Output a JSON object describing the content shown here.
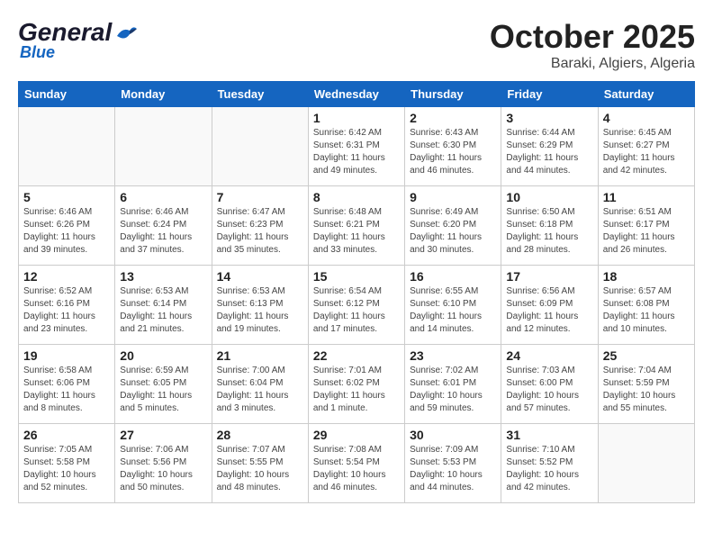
{
  "header": {
    "logo_general": "General",
    "logo_blue": "Blue",
    "month": "October 2025",
    "location": "Baraki, Algiers, Algeria"
  },
  "weekdays": [
    "Sunday",
    "Monday",
    "Tuesday",
    "Wednesday",
    "Thursday",
    "Friday",
    "Saturday"
  ],
  "rows": [
    [
      {
        "day": "",
        "info": ""
      },
      {
        "day": "",
        "info": ""
      },
      {
        "day": "",
        "info": ""
      },
      {
        "day": "1",
        "info": "Sunrise: 6:42 AM\nSunset: 6:31 PM\nDaylight: 11 hours\nand 49 minutes."
      },
      {
        "day": "2",
        "info": "Sunrise: 6:43 AM\nSunset: 6:30 PM\nDaylight: 11 hours\nand 46 minutes."
      },
      {
        "day": "3",
        "info": "Sunrise: 6:44 AM\nSunset: 6:29 PM\nDaylight: 11 hours\nand 44 minutes."
      },
      {
        "day": "4",
        "info": "Sunrise: 6:45 AM\nSunset: 6:27 PM\nDaylight: 11 hours\nand 42 minutes."
      }
    ],
    [
      {
        "day": "5",
        "info": "Sunrise: 6:46 AM\nSunset: 6:26 PM\nDaylight: 11 hours\nand 39 minutes."
      },
      {
        "day": "6",
        "info": "Sunrise: 6:46 AM\nSunset: 6:24 PM\nDaylight: 11 hours\nand 37 minutes."
      },
      {
        "day": "7",
        "info": "Sunrise: 6:47 AM\nSunset: 6:23 PM\nDaylight: 11 hours\nand 35 minutes."
      },
      {
        "day": "8",
        "info": "Sunrise: 6:48 AM\nSunset: 6:21 PM\nDaylight: 11 hours\nand 33 minutes."
      },
      {
        "day": "9",
        "info": "Sunrise: 6:49 AM\nSunset: 6:20 PM\nDaylight: 11 hours\nand 30 minutes."
      },
      {
        "day": "10",
        "info": "Sunrise: 6:50 AM\nSunset: 6:18 PM\nDaylight: 11 hours\nand 28 minutes."
      },
      {
        "day": "11",
        "info": "Sunrise: 6:51 AM\nSunset: 6:17 PM\nDaylight: 11 hours\nand 26 minutes."
      }
    ],
    [
      {
        "day": "12",
        "info": "Sunrise: 6:52 AM\nSunset: 6:16 PM\nDaylight: 11 hours\nand 23 minutes."
      },
      {
        "day": "13",
        "info": "Sunrise: 6:53 AM\nSunset: 6:14 PM\nDaylight: 11 hours\nand 21 minutes."
      },
      {
        "day": "14",
        "info": "Sunrise: 6:53 AM\nSunset: 6:13 PM\nDaylight: 11 hours\nand 19 minutes."
      },
      {
        "day": "15",
        "info": "Sunrise: 6:54 AM\nSunset: 6:12 PM\nDaylight: 11 hours\nand 17 minutes."
      },
      {
        "day": "16",
        "info": "Sunrise: 6:55 AM\nSunset: 6:10 PM\nDaylight: 11 hours\nand 14 minutes."
      },
      {
        "day": "17",
        "info": "Sunrise: 6:56 AM\nSunset: 6:09 PM\nDaylight: 11 hours\nand 12 minutes."
      },
      {
        "day": "18",
        "info": "Sunrise: 6:57 AM\nSunset: 6:08 PM\nDaylight: 11 hours\nand 10 minutes."
      }
    ],
    [
      {
        "day": "19",
        "info": "Sunrise: 6:58 AM\nSunset: 6:06 PM\nDaylight: 11 hours\nand 8 minutes."
      },
      {
        "day": "20",
        "info": "Sunrise: 6:59 AM\nSunset: 6:05 PM\nDaylight: 11 hours\nand 5 minutes."
      },
      {
        "day": "21",
        "info": "Sunrise: 7:00 AM\nSunset: 6:04 PM\nDaylight: 11 hours\nand 3 minutes."
      },
      {
        "day": "22",
        "info": "Sunrise: 7:01 AM\nSunset: 6:02 PM\nDaylight: 11 hours\nand 1 minute."
      },
      {
        "day": "23",
        "info": "Sunrise: 7:02 AM\nSunset: 6:01 PM\nDaylight: 10 hours\nand 59 minutes."
      },
      {
        "day": "24",
        "info": "Sunrise: 7:03 AM\nSunset: 6:00 PM\nDaylight: 10 hours\nand 57 minutes."
      },
      {
        "day": "25",
        "info": "Sunrise: 7:04 AM\nSunset: 5:59 PM\nDaylight: 10 hours\nand 55 minutes."
      }
    ],
    [
      {
        "day": "26",
        "info": "Sunrise: 7:05 AM\nSunset: 5:58 PM\nDaylight: 10 hours\nand 52 minutes."
      },
      {
        "day": "27",
        "info": "Sunrise: 7:06 AM\nSunset: 5:56 PM\nDaylight: 10 hours\nand 50 minutes."
      },
      {
        "day": "28",
        "info": "Sunrise: 7:07 AM\nSunset: 5:55 PM\nDaylight: 10 hours\nand 48 minutes."
      },
      {
        "day": "29",
        "info": "Sunrise: 7:08 AM\nSunset: 5:54 PM\nDaylight: 10 hours\nand 46 minutes."
      },
      {
        "day": "30",
        "info": "Sunrise: 7:09 AM\nSunset: 5:53 PM\nDaylight: 10 hours\nand 44 minutes."
      },
      {
        "day": "31",
        "info": "Sunrise: 7:10 AM\nSunset: 5:52 PM\nDaylight: 10 hours\nand 42 minutes."
      },
      {
        "day": "",
        "info": ""
      }
    ]
  ]
}
